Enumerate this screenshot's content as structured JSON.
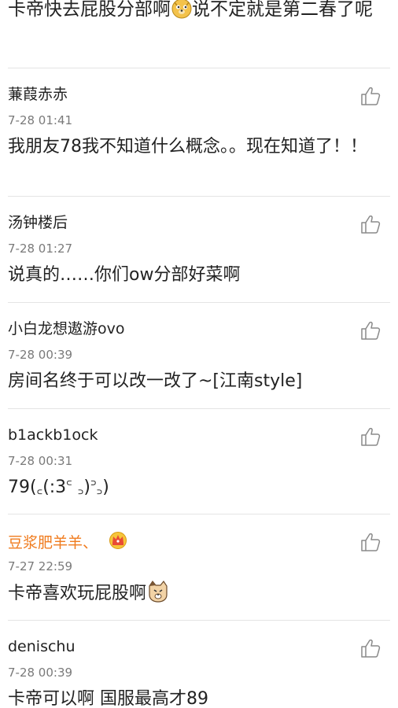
{
  "top_fragment": {
    "text_before_emoji": "卡帝快去屁股分部啊",
    "emoji": "doge-emoji",
    "text_after_emoji": "说不定就是第二春了呢"
  },
  "comments": [
    {
      "username": "蒹葭赤赤",
      "timestamp": "7-28 01:41",
      "content": "我朋友78我不知道什么概念。。现在知道了！！",
      "like_icon": "thumbs-up-icon"
    },
    {
      "username": "汤钟楼后",
      "timestamp": "7-28 01:27",
      "content": "说真的……你们ow分部好菜啊",
      "like_icon": "thumbs-up-icon"
    },
    {
      "username": "小白龙想遨游ovo",
      "timestamp": "7-28 00:39",
      "content": "房间名终于可以改一改了~[江南style]",
      "like_icon": "thumbs-up-icon"
    },
    {
      "username": "b1ackb1ock",
      "timestamp": "7-28 00:31",
      "content": "79(꜀(:3꜂ ꜆)꜄꜆)",
      "like_icon": "thumbs-up-icon"
    },
    {
      "username": "豆浆肥羊羊、",
      "username_color": "#f07c1f",
      "badge": "crown-icon",
      "timestamp": "7-27 22:59",
      "content": "卡帝喜欢玩屁股啊",
      "content_emoji": "cat-face-emoji",
      "like_icon": "thumbs-up-icon"
    },
    {
      "username": "denischu",
      "timestamp": "7-28 00:39",
      "content": "卡帝可以啊 国服最高才89",
      "like_icon": "thumbs-up-icon"
    }
  ]
}
